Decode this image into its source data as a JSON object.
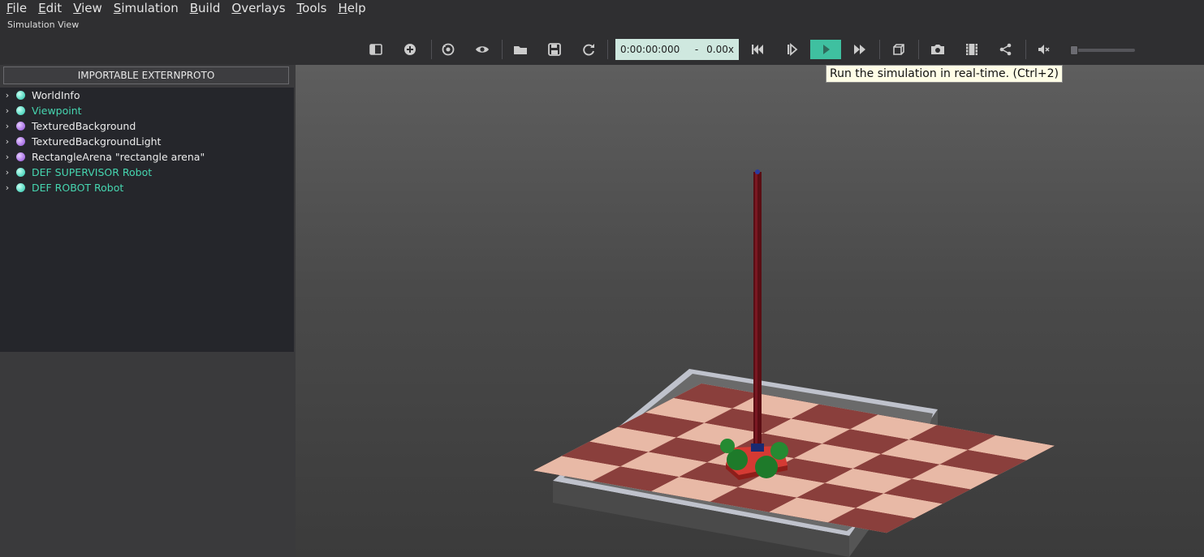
{
  "menubar": {
    "items": [
      "File",
      "Edit",
      "View",
      "Simulation",
      "Build",
      "Overlays",
      "Tools",
      "Help"
    ]
  },
  "view_title": "Simulation View",
  "toolbar": {
    "time": "0:00:00:000",
    "dash": "-",
    "speed": "0.00x",
    "buttons": [
      "sidebar-toggle-icon",
      "add-node-icon",
      "reset-view-icon",
      "visibility-icon",
      "open-world-icon",
      "save-world-icon",
      "reload-world-icon",
      "rewind-icon",
      "step-icon",
      "run-icon",
      "fast-forward-icon",
      "perspective-icon",
      "screenshot-icon",
      "movie-icon",
      "share-icon",
      "mute-icon"
    ],
    "accent_color": "#3fc0a0"
  },
  "tooltip": "Run the simulation in real-time. (Ctrl+2)",
  "sidebar": {
    "proto_button": "IMPORTABLE EXTERNPROTO",
    "nodes": [
      {
        "label": "WorldInfo",
        "dot": "cyan",
        "text_color": "white"
      },
      {
        "label": "Viewpoint",
        "dot": "cyan",
        "text_color": "green"
      },
      {
        "label": "TexturedBackground",
        "dot": "purple",
        "text_color": "white"
      },
      {
        "label": "TexturedBackgroundLight",
        "dot": "purple",
        "text_color": "white"
      },
      {
        "label": "RectangleArena \"rectangle arena\"",
        "dot": "purple",
        "text_color": "white"
      },
      {
        "label": "DEF SUPERVISOR Robot",
        "dot": "cyan",
        "text_color": "green"
      },
      {
        "label": "DEF ROBOT Robot",
        "dot": "cyan",
        "text_color": "green"
      }
    ]
  }
}
